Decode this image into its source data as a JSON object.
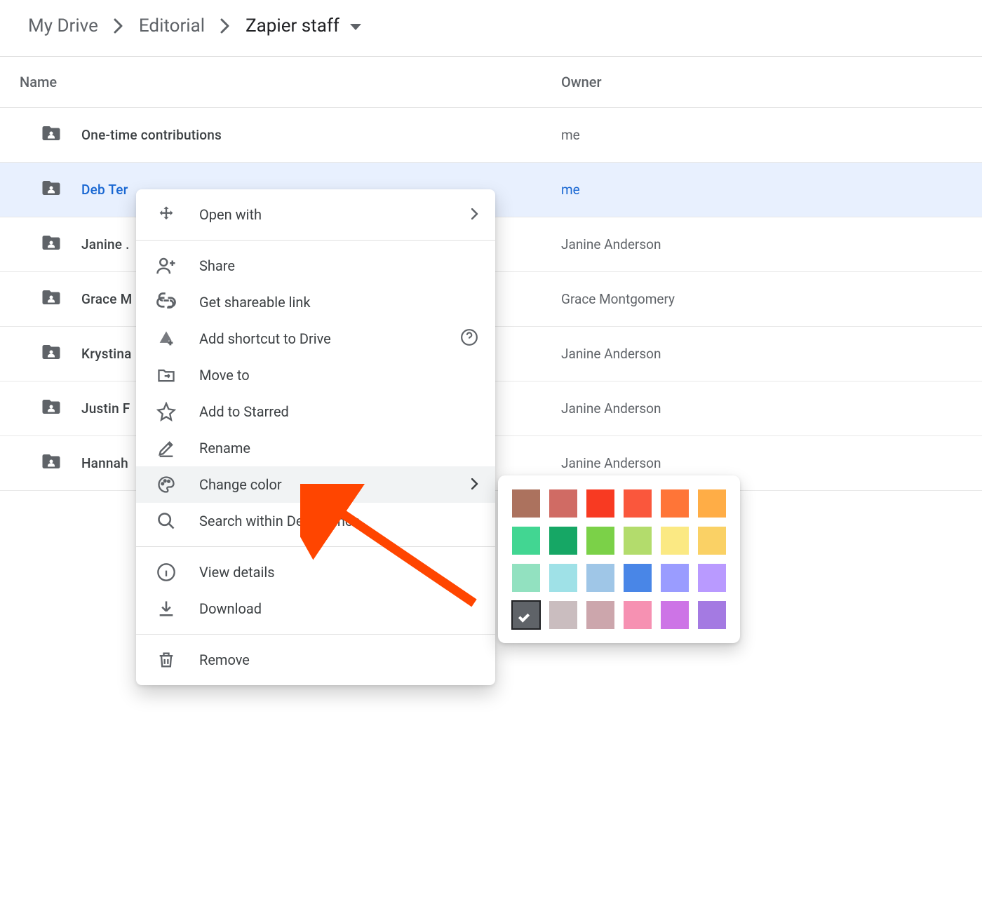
{
  "breadcrumb": {
    "items": [
      "My Drive",
      "Editorial",
      "Zapier staff"
    ]
  },
  "columns": {
    "name": "Name",
    "owner": "Owner"
  },
  "rows": [
    {
      "name": "One-time contributions",
      "owner": "me",
      "selected": false
    },
    {
      "name": "Deb Ter",
      "owner": "me",
      "selected": true
    },
    {
      "name": "Janine .",
      "owner": "Janine Anderson",
      "selected": false
    },
    {
      "name": "Grace M",
      "owner": "Grace Montgomery",
      "selected": false
    },
    {
      "name": "Krystina",
      "owner": "Janine Anderson",
      "selected": false
    },
    {
      "name": "Justin F",
      "owner": "Janine Anderson",
      "selected": false
    },
    {
      "name": "Hannah",
      "owner": "Janine Anderson",
      "selected": false
    }
  ],
  "menu": {
    "open_with": "Open with",
    "share": "Share",
    "get_link": "Get shareable link",
    "add_shortcut": "Add shortcut to Drive",
    "move_to": "Move to",
    "star": "Add to Starred",
    "rename": "Rename",
    "change_color": "Change color",
    "search_within": "Search within Deb Tennen",
    "view_details": "View details",
    "download": "Download",
    "remove": "Remove"
  },
  "colors": {
    "palette": [
      "#ac725e",
      "#d06b64",
      "#f83a22",
      "#fa573c",
      "#ff7537",
      "#ffad46",
      "#42d692",
      "#16a765",
      "#7bd148",
      "#b3dc6c",
      "#fbe983",
      "#fad165",
      "#92e1c0",
      "#9fe1e7",
      "#9fc6e7",
      "#4986e7",
      "#9a9cff",
      "#b99aff",
      "#5f6368",
      "#cabdbf",
      "#cca6ac",
      "#f691b2",
      "#cd74e6",
      "#a47ae2"
    ],
    "selected_index": 18
  }
}
